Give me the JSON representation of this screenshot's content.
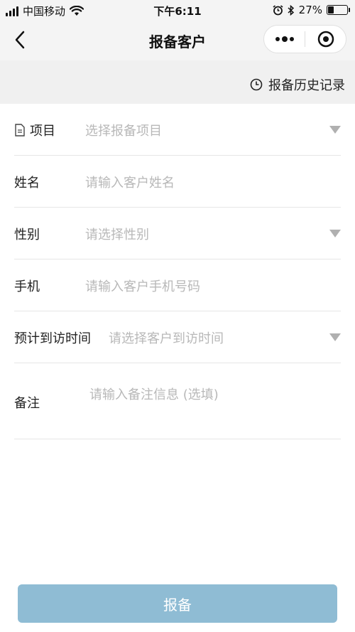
{
  "status_bar": {
    "carrier": "中国移动",
    "time": "下午6:11",
    "battery_text": "27%",
    "battery_level": 0.27
  },
  "nav": {
    "title": "报备客户"
  },
  "history": {
    "label": "报备历史记录"
  },
  "form": {
    "project": {
      "label": "项目",
      "placeholder": "选择报备项目"
    },
    "name": {
      "label": "姓名",
      "placeholder": "请输入客户姓名"
    },
    "gender": {
      "label": "性别",
      "placeholder": "请选择性别"
    },
    "phone": {
      "label": "手机",
      "placeholder": "请输入客户手机号码"
    },
    "visit_time": {
      "label": "预计到访时间",
      "placeholder": "请选择客户到访时间"
    },
    "remark": {
      "label": "备注",
      "placeholder": "请输入备注信息 (选填)"
    }
  },
  "submit": {
    "label": "报备"
  },
  "colors": {
    "accent_button": "#8fbcd4",
    "placeholder": "#b8b8b8",
    "nav_background": "#f4f4f4"
  }
}
